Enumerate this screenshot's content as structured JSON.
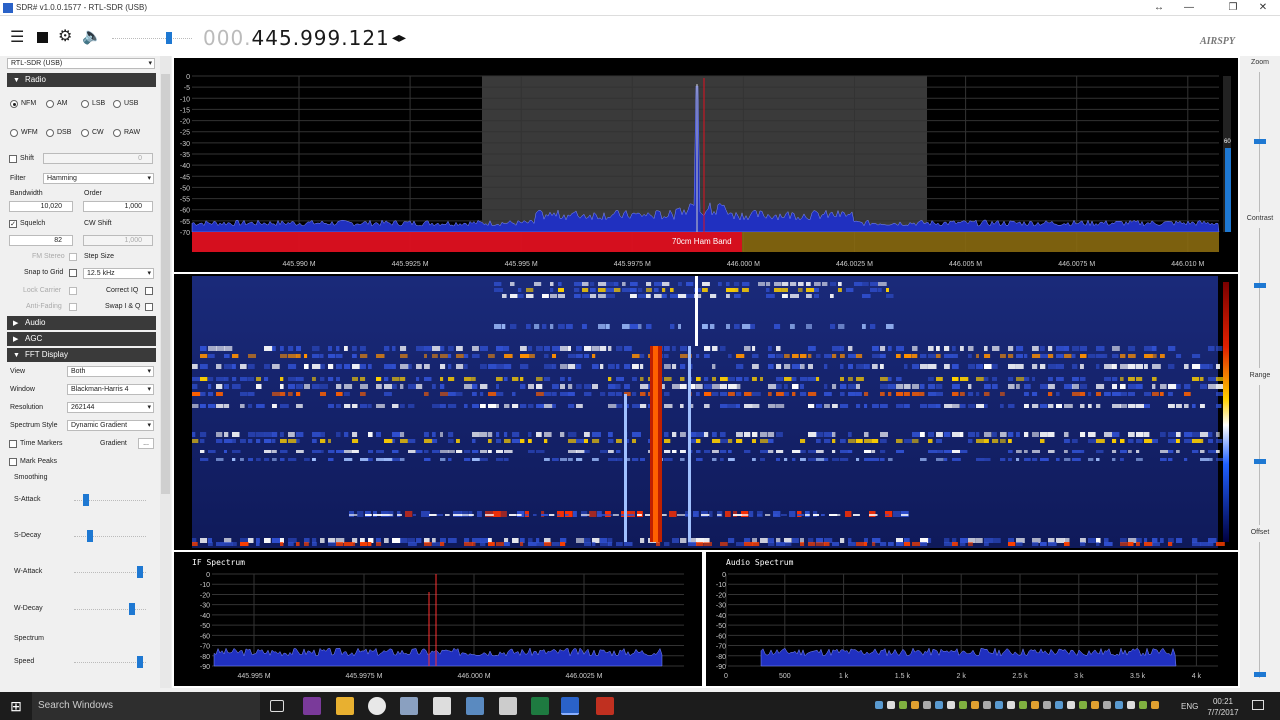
{
  "window": {
    "title": "SDR# v1.0.0.1577 - RTL-SDR (USB)"
  },
  "toolbar": {
    "freq_dim": "000.",
    "freq_main": "445.999.121",
    "logo": "AIRSPY"
  },
  "sidebar": {
    "device": "RTL-SDR (USB)",
    "sections": {
      "radio": "Radio",
      "audio": "Audio",
      "agc": "AGC",
      "fft": "FFT Display"
    },
    "modes_row1": [
      "NFM",
      "AM",
      "LSB",
      "USB"
    ],
    "modes_row2": [
      "WFM",
      "DSB",
      "CW",
      "RAW"
    ],
    "selected_mode": "NFM",
    "shift_label": "Shift",
    "shift_value": "0",
    "filter_label": "Filter",
    "filter_value": "Hamming",
    "bandwidth_label": "Bandwidth",
    "bandwidth_value": "10,020",
    "order_label": "Order",
    "order_value": "1,000",
    "squelch_label": "Squelch",
    "squelch_value": "82",
    "cwshift_label": "CW Shift",
    "cwshift_value": "1,000",
    "fmstereo_label": "FM Stereo",
    "stepsize_label": "Step Size",
    "snaptogrid_label": "Snap to Grid",
    "stepsize_value": "12.5 kHz",
    "lockcarrier_label": "Lock Carrier",
    "correctiq_label": "Correct IQ",
    "antifading_label": "Anti-Fading",
    "swapiq_label": "Swap I & Q",
    "view_label": "View",
    "view_value": "Both",
    "window_label": "Window",
    "window_value": "Blackman-Harris 4",
    "resolution_label": "Resolution",
    "resolution_value": "262144",
    "spectrumstyle_label": "Spectrum Style",
    "spectrumstyle_value": "Dynamic Gradient",
    "timemarkers_label": "Time Markers",
    "gradient_label": "Gradient",
    "gradient_btn": "...",
    "markpeaks_label": "Mark Peaks",
    "smoothing_label": "Smoothing",
    "sattack_label": "S-Attack",
    "sdecay_label": "S-Decay",
    "wattack_label": "W-Attack",
    "wdecay_label": "W-Decay",
    "spectrum_label": "Spectrum",
    "speed_label": "Speed"
  },
  "spectrum": {
    "db_ticks": [
      "0",
      "-5",
      "-10",
      "-15",
      "-20",
      "-25",
      "-30",
      "-35",
      "-40",
      "-45",
      "-50",
      "-55",
      "-60",
      "-65",
      "-70"
    ],
    "freq_ticks": [
      "445.990 M",
      "445.9925 M",
      "445.995 M",
      "445.9975 M",
      "446.000 M",
      "446.0025 M",
      "446.005 M",
      "446.0075 M",
      "446.010 M"
    ],
    "band_label": "70cm Ham Band",
    "level_marker": "60"
  },
  "if_spectrum": {
    "title": "IF Spectrum",
    "db_ticks": [
      "0",
      "-10",
      "-20",
      "-30",
      "-40",
      "-50",
      "-60",
      "-70",
      "-80",
      "-90"
    ],
    "freq_ticks": [
      "445.995 M",
      "445.9975 M",
      "446.000 M",
      "446.0025 M"
    ]
  },
  "audio_spectrum": {
    "title": "Audio Spectrum",
    "db_ticks": [
      "0",
      "-10",
      "-20",
      "-30",
      "-40",
      "-50",
      "-60",
      "-70",
      "-80",
      "-90"
    ],
    "freq_ticks": [
      "0",
      "500",
      "1 k",
      "1.5 k",
      "2 k",
      "2.5 k",
      "3 k",
      "3.5 k",
      "4 k"
    ]
  },
  "rightpanel": {
    "zoom": "Zoom",
    "contrast": "Contrast",
    "range": "Range",
    "offset": "Offset"
  },
  "taskbar": {
    "search": "Search Windows",
    "lang": "ENG",
    "time": "00:21",
    "date": "7/7/2017"
  },
  "colors": {
    "accent": "#1e78d2",
    "band": "#e01020",
    "spectrum_fill": "#2030c0"
  }
}
